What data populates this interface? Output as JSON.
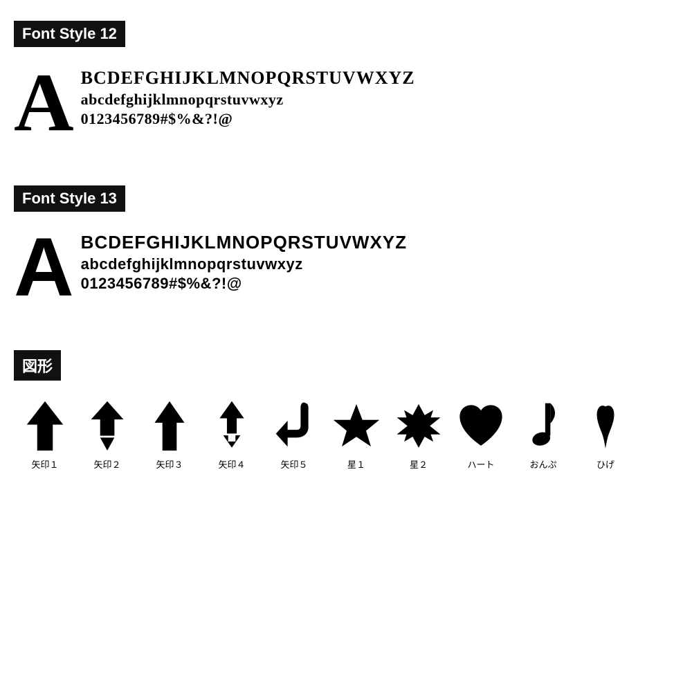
{
  "font12": {
    "header": "Font Style 12",
    "big_letter": "A",
    "line1": "BCDEFGHIJKLMNOPQRSTUVWXYZ",
    "line2": "abcdefghijklmnopqrstuvwxyz",
    "line3": "0123456789#$%&?!@"
  },
  "font13": {
    "header": "Font Style 13",
    "big_letter": "A",
    "line1": "BCDEFGHIJKLMNOPQRSTUVWXYZ",
    "line2": "abcdefghijklmnopqrstuvwxyz",
    "line3": "0123456789#$%&?!@"
  },
  "shapes": {
    "header": "図形",
    "items": [
      {
        "label": "矢印１",
        "id": "arrow1"
      },
      {
        "label": "矢印２",
        "id": "arrow2"
      },
      {
        "label": "矢印３",
        "id": "arrow3"
      },
      {
        "label": "矢印４",
        "id": "arrow4"
      },
      {
        "label": "矢印５",
        "id": "arrow5"
      },
      {
        "label": "星１",
        "id": "star1"
      },
      {
        "label": "星２",
        "id": "star2"
      },
      {
        "label": "ハート",
        "id": "heart"
      },
      {
        "label": "おんぷ",
        "id": "music"
      },
      {
        "label": "ひげ",
        "id": "mustache"
      }
    ]
  }
}
